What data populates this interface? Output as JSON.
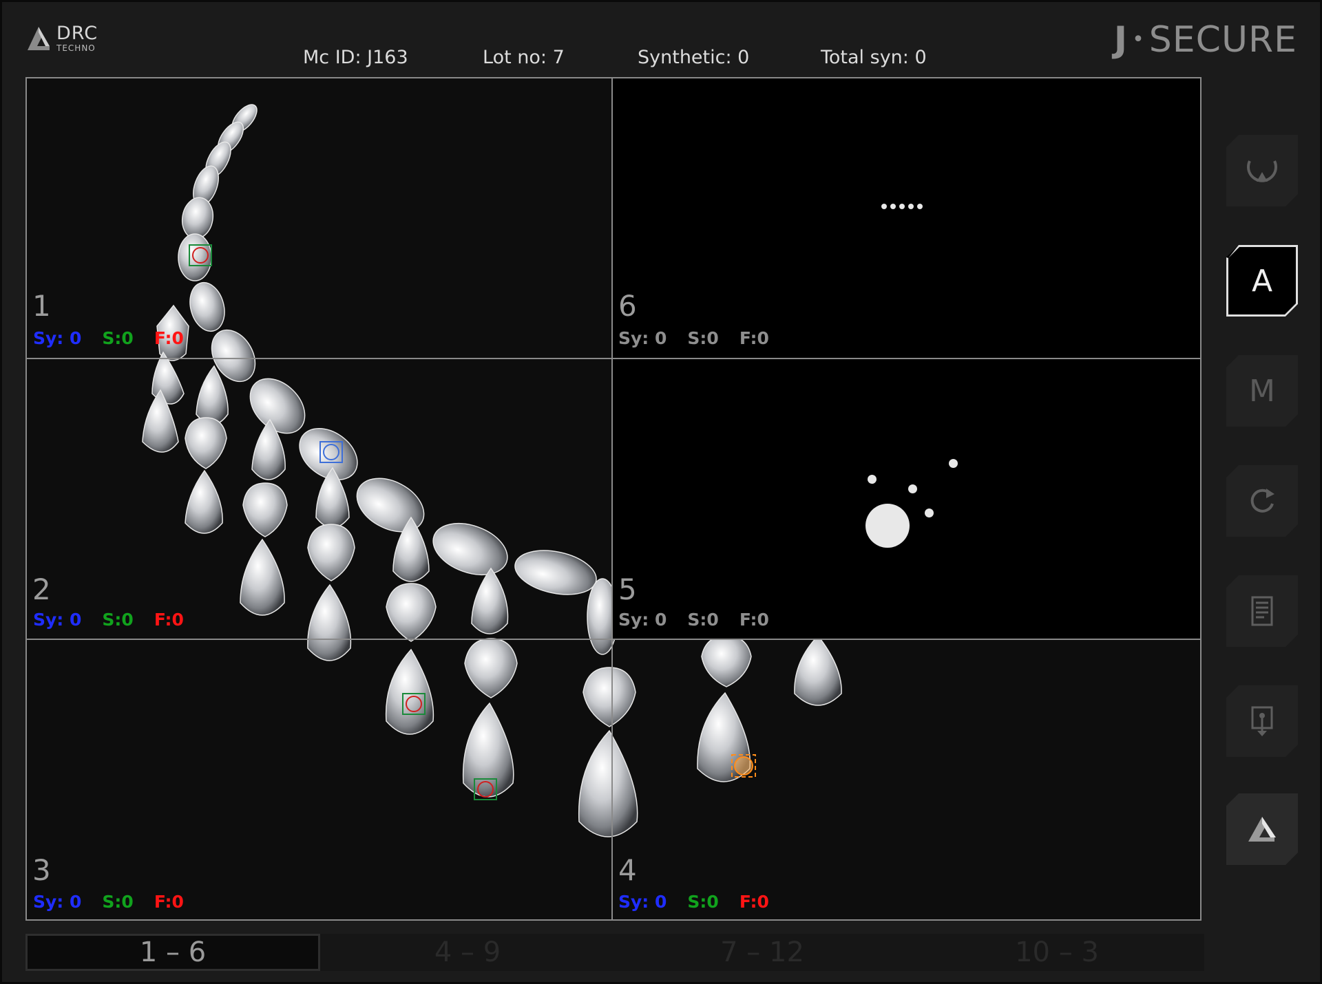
{
  "header": {
    "logo_main": "DRC",
    "logo_sub": "TECHNO",
    "brand_j": "J",
    "brand_name": "SECURE",
    "mc_id": "Mc ID: J163",
    "lot_no": "Lot no: 7",
    "synthetic": "Synthetic: 0",
    "total_syn": "Total syn: 0"
  },
  "cells": [
    {
      "num": "1",
      "sy": "Sy: 0",
      "s": "S:0",
      "f": "F:0"
    },
    {
      "num": "2",
      "sy": "Sy: 0",
      "s": "S:0",
      "f": "F:0"
    },
    {
      "num": "3",
      "sy": "Sy: 0",
      "s": "S:0",
      "f": "F:0"
    },
    {
      "num": "4",
      "sy": "Sy: 0",
      "s": "S:0",
      "f": "F:0"
    },
    {
      "num": "5",
      "sy": "Sy: 0",
      "s": "S:0",
      "f": "F:0"
    },
    {
      "num": "6",
      "sy": "Sy: 0",
      "s": "S:0",
      "f": "F:0"
    }
  ],
  "sidebar": {
    "auto_label": "A",
    "manual_label": "M"
  },
  "tabs": [
    {
      "label": "1 – 6",
      "active": true
    },
    {
      "label": "4 – 9",
      "active": false
    },
    {
      "label": "7 – 12",
      "active": false
    },
    {
      "label": "10 – 3",
      "active": false
    }
  ],
  "icons": [
    "drc-logo-icon",
    "capture-icon",
    "refresh-icon",
    "report-icon",
    "export-icon",
    "drc-brand-icon"
  ],
  "colors": {
    "synthetic": "#1f2dff",
    "safe": "#11a21d",
    "fail": "#ff1414"
  }
}
